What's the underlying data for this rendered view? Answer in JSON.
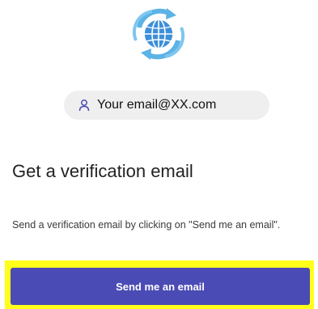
{
  "logo": {
    "icon": "globe-sync-icon",
    "colors": {
      "outer": "#59b5e8",
      "inner": "#3d8fd8",
      "lines": "#ffffff"
    }
  },
  "email_chip": {
    "icon": "person-icon",
    "text": "Your email@XX.com"
  },
  "heading": "Get a verification email",
  "description": "Send a verification email by clicking on \"Send me an email\".",
  "primary_button": {
    "label": "Send me an email",
    "color": "#4b4bb5",
    "highlight_color": "#ffff1a"
  }
}
